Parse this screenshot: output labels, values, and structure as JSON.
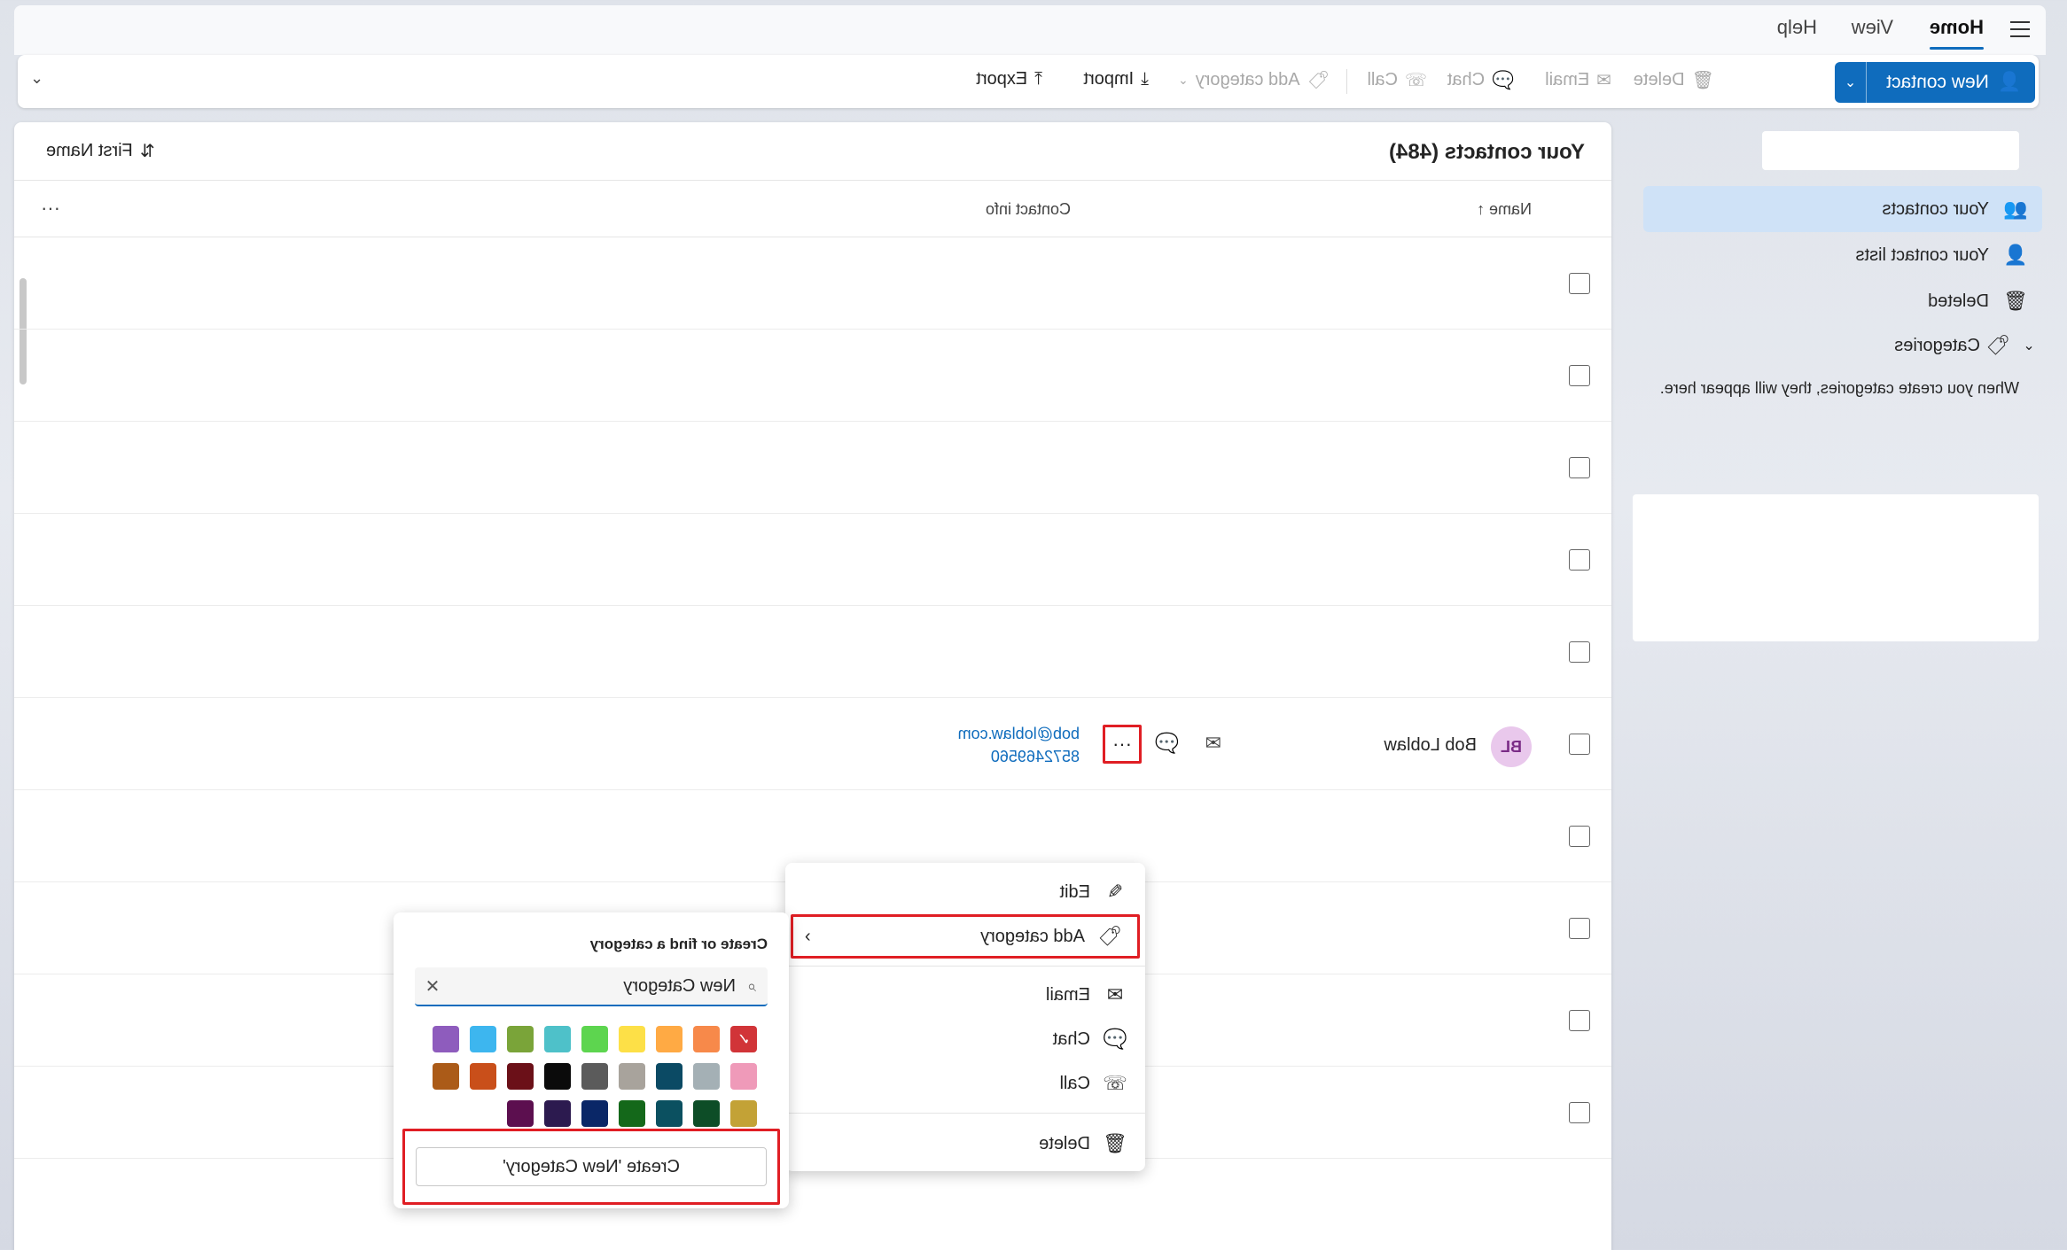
{
  "ribbon": {
    "tabs": [
      "Home",
      "View",
      "Help"
    ],
    "new_contact_label": "New contact",
    "toolbar": {
      "delete": "Delete",
      "email": "Email",
      "chat": "Chat",
      "call": "Call",
      "add_category": "Add category",
      "import": "Import",
      "export": "Export"
    }
  },
  "nav": {
    "items": [
      {
        "label": "Your contacts",
        "icon": "people-icon"
      },
      {
        "label": "Your contact lists",
        "icon": "contact-list-icon"
      },
      {
        "label": "Deleted",
        "icon": "trash-icon"
      },
      {
        "label": "Categories",
        "icon": "tag-icon"
      }
    ],
    "categories_note": "When you create categories, they will appear here."
  },
  "main": {
    "title": "Your contacts (484)",
    "sort_label": "First Name",
    "columns": {
      "name": "Name",
      "contact": "Contact info",
      "more": "···"
    }
  },
  "contact": {
    "initials": "BL",
    "name": "Bob Loblaw",
    "email": "bob@loblaw.com",
    "phone": "8572469560",
    "more": "···"
  },
  "context_menu": {
    "edit": "Edit",
    "add_category": "Add category",
    "email": "Email",
    "chat": "Chat",
    "call": "Call",
    "delete": "Delete"
  },
  "category_flyout": {
    "title": "Create or find a category",
    "search_value": "New Category",
    "create_label": "Create 'New Category'",
    "swatches": [
      "#d13438",
      "#f7894a",
      "#ffaa44",
      "#fde047",
      "#5dd54f",
      "#4ec1c9",
      "#7aa439",
      "#3db6ef",
      "#8e5cbd",
      "#ef9ab9",
      "#a4b0b5",
      "#0b4a64",
      "#a8a39c",
      "#5b5b5b",
      "#0b0b0b",
      "#6b1018",
      "#c94f1a",
      "#ab5b18",
      "#c3a236",
      "#0d4d27",
      "#0b5060",
      "#14681a",
      "#0a2767",
      "#2c1a4f",
      "#5c0f4f"
    ],
    "accent": "#0f6cbd",
    "highlight": "#e01e24"
  }
}
